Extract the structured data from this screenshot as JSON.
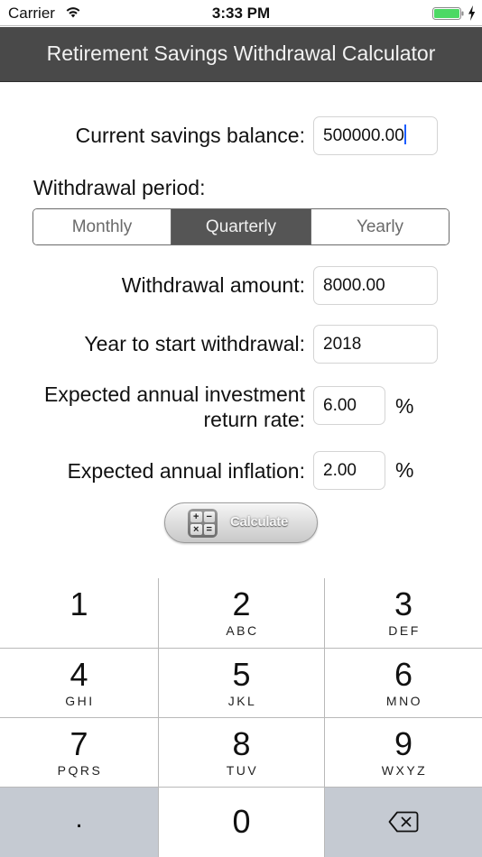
{
  "status_bar": {
    "carrier": "Carrier",
    "time": "3:33 PM",
    "battery_color": "#4cd964"
  },
  "nav": {
    "title": "Retirement Savings Withdrawal Calculator",
    "background": "#494949"
  },
  "form": {
    "balance": {
      "label": "Current savings balance:",
      "value": "500000.00",
      "focused": true
    },
    "period": {
      "label": "Withdrawal period:",
      "options": [
        "Monthly",
        "Quarterly",
        "Yearly"
      ],
      "selected": "Quarterly"
    },
    "amount": {
      "label": "Withdrawal amount:",
      "value": "8000.00"
    },
    "start_year": {
      "label": "Year to start withdrawal:",
      "value": "2018"
    },
    "return_rate": {
      "label_line1": "Expected annual investment",
      "label_line2": "return rate:",
      "value": "6.00",
      "unit": "%"
    },
    "inflation": {
      "label": "Expected annual inflation:",
      "value": "2.00",
      "unit": "%"
    }
  },
  "calculate_button": {
    "label": "Calculate",
    "icon_symbols": [
      "+",
      "−",
      "×",
      "="
    ]
  },
  "keypad": {
    "keys": [
      {
        "digit": "1",
        "letters": ""
      },
      {
        "digit": "2",
        "letters": "ABC"
      },
      {
        "digit": "3",
        "letters": "DEF"
      },
      {
        "digit": "4",
        "letters": "GHI"
      },
      {
        "digit": "5",
        "letters": "JKL"
      },
      {
        "digit": "6",
        "letters": "MNO"
      },
      {
        "digit": "7",
        "letters": "PQRS"
      },
      {
        "digit": "8",
        "letters": "TUV"
      },
      {
        "digit": "9",
        "letters": "WXYZ"
      }
    ],
    "decimal": ".",
    "zero": "0",
    "delete_icon": "backspace-icon"
  }
}
